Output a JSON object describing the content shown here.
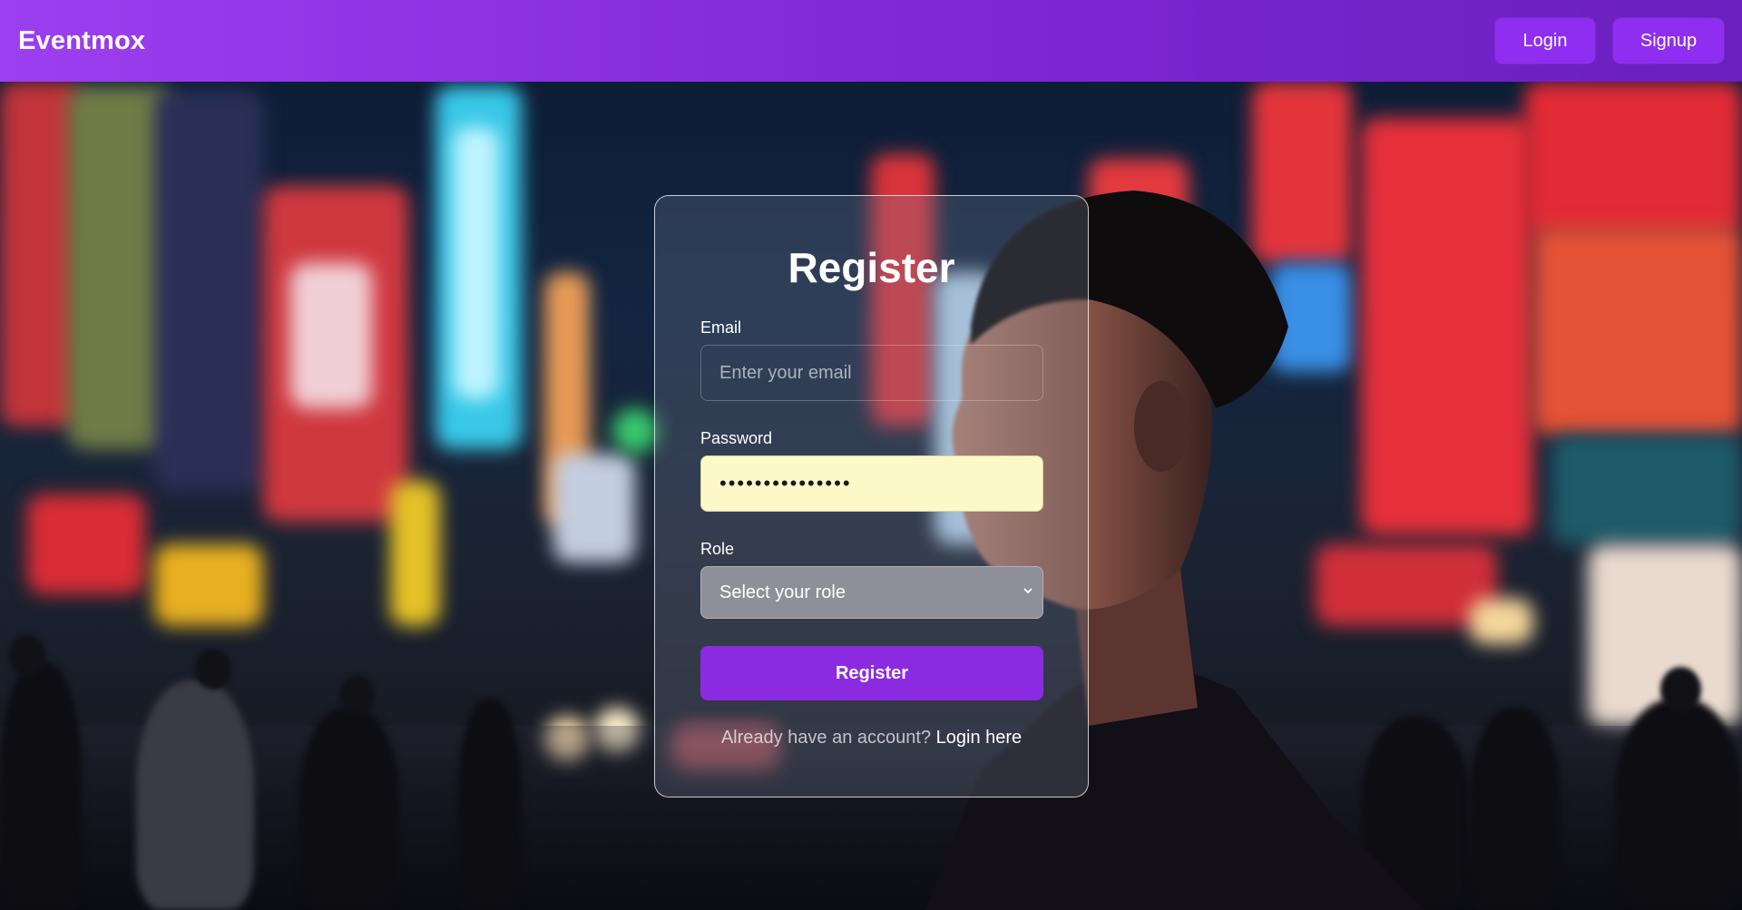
{
  "navbar": {
    "brand": "Eventmox",
    "login_label": "Login",
    "signup_label": "Signup"
  },
  "form": {
    "title": "Register",
    "email": {
      "label": "Email",
      "placeholder": "Enter your email",
      "value": ""
    },
    "password": {
      "label": "Password",
      "value": "•••••••••••••••"
    },
    "role": {
      "label": "Role",
      "selected": "Select your role"
    },
    "submit_label": "Register",
    "footer_text": "Already have an account?",
    "footer_link": "Login here"
  },
  "colors": {
    "navbar_start": "#9b3ff0",
    "navbar_end": "#6a1fbf",
    "accent": "#8a2be2",
    "password_fill": "#fdf8c8"
  },
  "icons": {
    "role_select": "chevron-down-icon"
  }
}
